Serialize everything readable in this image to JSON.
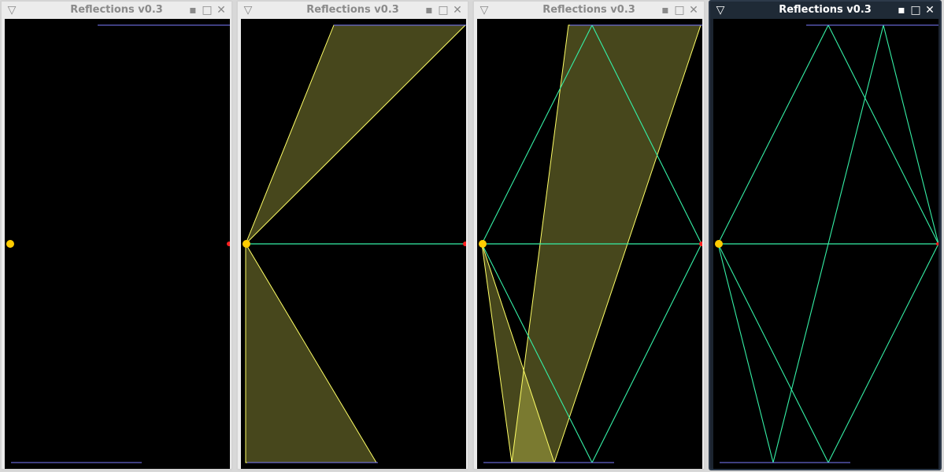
{
  "desktop": {
    "windows": [
      {
        "title": "Reflections v0.3",
        "controls": {
          "menu": "▽",
          "minimize": "▪",
          "maximize": "□",
          "close": "✕"
        }
      },
      {
        "title": "Reflections v0.3",
        "controls": {
          "menu": "▽",
          "minimize": "▪",
          "maximize": "□",
          "close": "✕"
        }
      },
      {
        "title": "Reflections v0.3",
        "controls": {
          "menu": "▽",
          "minimize": "▪",
          "maximize": "□",
          "close": "✕"
        }
      },
      {
        "title": "Reflections v0.3",
        "controls": {
          "menu": "▽",
          "minimize": "▪",
          "maximize": "□",
          "close": "✕"
        }
      }
    ]
  },
  "colors": {
    "desktop_background": "#2a2f36",
    "window_background": "#ececec",
    "active_window_background": "#1f2a36",
    "canvas_background": "#000000",
    "mirror_line": "#7c7cff",
    "source_point": "#ffcc00",
    "target_point": "#ff2020",
    "reflection_area": "#ffff66",
    "ray_line": "#35f0a6"
  }
}
